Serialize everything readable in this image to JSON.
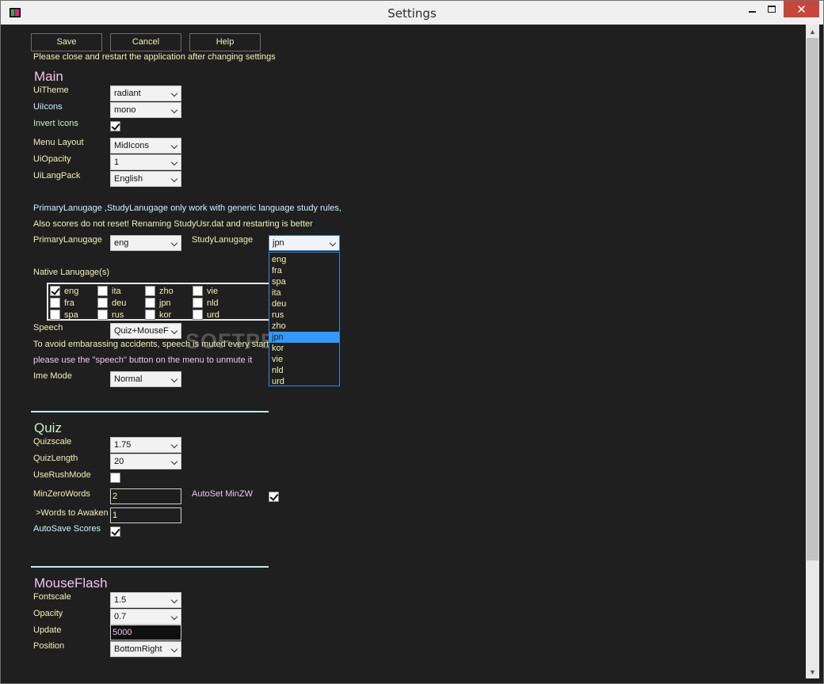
{
  "window": {
    "title": "Settings",
    "close_glyph": "✕"
  },
  "toolbar": {
    "save": "Save",
    "cancel": "Cancel",
    "help": "Help"
  },
  "notice": "Please close and restart the application after changing settings",
  "main": {
    "heading": "Main",
    "uitheme": {
      "label": "UiTheme",
      "value": "radiant"
    },
    "uiicons": {
      "label": "UiIcons",
      "value": "mono"
    },
    "invert_icons": {
      "label": "Invert Icons",
      "checked": true
    },
    "menu_layout": {
      "label": "Menu Layout",
      "value": "MidIcons"
    },
    "uiopacity": {
      "label": "UiOpacity",
      "value": "1"
    },
    "uilangpack": {
      "label": "UiLangPack",
      "value": "English"
    },
    "warning1": "PrimaryLanugage ,StudyLanugage only work with generic language study rules,",
    "warning2": "Also scores do not reset! Renaming StudyUsr.dat and restarting is better",
    "primary_language": {
      "label": "PrimaryLanugage",
      "value": "eng"
    },
    "study_language": {
      "label": "StudyLanugage",
      "value": "jpn",
      "options": [
        "eng",
        "fra",
        "spa",
        "ita",
        "deu",
        "rus",
        "zho",
        "jpn",
        "kor",
        "vie",
        "nld",
        "urd"
      ],
      "selected_index": 7
    },
    "native_languages": {
      "label": "Native Lanugage(s)",
      "items": [
        {
          "code": "eng",
          "checked": true
        },
        {
          "code": "ita",
          "checked": false
        },
        {
          "code": "zho",
          "checked": false
        },
        {
          "code": "vie",
          "checked": false
        },
        {
          "code": "fra",
          "checked": false
        },
        {
          "code": "deu",
          "checked": false
        },
        {
          "code": "jpn",
          "checked": false
        },
        {
          "code": "nld",
          "checked": false
        },
        {
          "code": "spa",
          "checked": false
        },
        {
          "code": "rus",
          "checked": false
        },
        {
          "code": "kor",
          "checked": false
        },
        {
          "code": "urd",
          "checked": false
        }
      ]
    },
    "speech": {
      "label": "Speech",
      "value": "Quiz+MouseF"
    },
    "speech_note1": "To avoid embarassing accidents, speech is muted every start",
    "speech_note2": "please use the \"speech\" button on the menu to unmute it",
    "ime_mode": {
      "label": "Ime Mode",
      "value": "Normal"
    }
  },
  "quiz": {
    "heading": "Quiz",
    "quizscale": {
      "label": "Quizscale",
      "value": "1.75"
    },
    "quizlength": {
      "label": "QuizLength",
      "value": "20"
    },
    "use_rush_mode": {
      "label": "UseRushMode",
      "checked": false
    },
    "min_zero_words": {
      "label": "MinZeroWords",
      "value": "2"
    },
    "autoset_minzw": {
      "label": "AutoSet MinZW",
      "checked": true
    },
    "words_to_awaken": {
      "label": ">Words to Awaken",
      "value": "1"
    },
    "autosave_scores": {
      "label": "AutoSave Scores",
      "checked": true
    }
  },
  "mouseflash": {
    "heading": "MouseFlash",
    "fontscale": {
      "label": "Fontscale",
      "value": "1.5"
    },
    "opacity": {
      "label": "Opacity",
      "value": "0.7"
    },
    "update": {
      "label": "Update",
      "value": "5000"
    },
    "position": {
      "label": "Position",
      "value": "BottomRight"
    }
  },
  "watermark": "SOFTPEDIA",
  "colors": {
    "background": "#1f1f1f",
    "label_yellow": "#f1f0b8",
    "label_pink": "#f2c3f0",
    "label_cyan": "#c9f5ff",
    "highlight": "#3399ff",
    "close_red": "#c7463c"
  }
}
